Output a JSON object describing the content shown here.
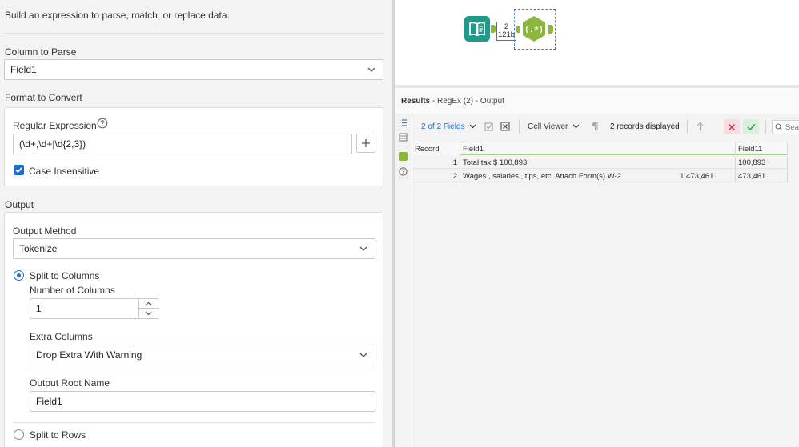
{
  "config": {
    "description": "Build an expression to parse, match, or replace data.",
    "column_to_parse": {
      "title": "Column to Parse",
      "value": "Field1"
    },
    "format_to_convert": {
      "title": "Format to Convert",
      "regex_label": "Regular Expression",
      "regex_value": "(\\d+,\\d+|\\d{2,3})",
      "case_insensitive_label": "Case Insensitive",
      "case_insensitive": true
    },
    "output": {
      "title": "Output",
      "method_label": "Output Method",
      "method_value": "Tokenize",
      "split_columns_label": "Split to Columns",
      "num_columns_label": "Number of Columns",
      "num_columns_value": "1",
      "extra_columns_label": "Extra Columns",
      "extra_columns_value": "Drop Extra With Warning",
      "root_name_label": "Output Root Name",
      "root_name_value": "Field1",
      "split_rows_label": "Split to Rows"
    }
  },
  "canvas": {
    "connector_count": "2",
    "connector_size": "121b",
    "regex_tool_symbol": "(.*)"
  },
  "results": {
    "title_bold": "Results",
    "title_rest": " - RegEx (2) - Output",
    "fields_label": "2 of 2 Fields",
    "viewer_label": "Cell Viewer",
    "records_label": "2 records displayed",
    "search_placeholder": "Sea",
    "columns": [
      "Record",
      "Field1",
      "Field11"
    ],
    "rows": [
      {
        "record": "1",
        "field1": "Total tax $ 100,893",
        "field1_extra": "",
        "field11": "100,893"
      },
      {
        "record": "2",
        "field1": "Wages , salaries , tips, etc. Attach Form(s) W-2",
        "field1_extra": "1 473,461.",
        "field11": "473,461"
      }
    ]
  },
  "colors": {
    "accent": "#1f6dcf",
    "input_tool": "#1d9a8a",
    "regex_tool": "#8bb73e",
    "cancel": "#d6303f",
    "apply": "#3e9a45"
  }
}
